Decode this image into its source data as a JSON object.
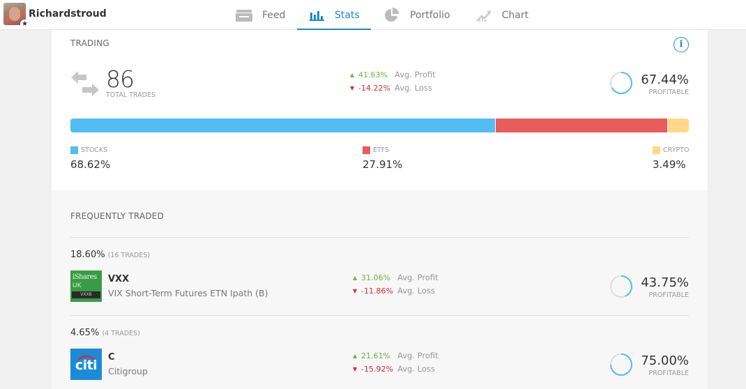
{
  "user": {
    "name": "Richardstroud",
    "badge_icon": "star-icon"
  },
  "nav": {
    "items": [
      {
        "label": "Feed",
        "icon": "feed-icon",
        "active": false
      },
      {
        "label": "Stats",
        "icon": "stats-icon",
        "active": true
      },
      {
        "label": "Portfolio",
        "icon": "portfolio-icon",
        "active": false
      },
      {
        "label": "Chart",
        "icon": "chart-icon",
        "active": false
      }
    ]
  },
  "trading": {
    "title": "TRADING",
    "info_icon": "i",
    "total_trades": "86",
    "total_trades_label": "TOTAL TRADES",
    "avg_profit": "41.63%",
    "avg_profit_label": "Avg. Profit",
    "avg_loss": "-14.22%",
    "avg_loss_label": "Avg. Loss",
    "profitable_pct": "67.44%",
    "profitable_value": 67.44,
    "profitable_label": "PROFITABLE",
    "allocation": [
      {
        "label": "STOCKS",
        "value_text": "68.62%",
        "value": 68.62,
        "color": "#52bcf3"
      },
      {
        "label": "ETFS",
        "value_text": "27.91%",
        "value": 27.91,
        "color": "#e85c5c"
      },
      {
        "label": "CRYPTO",
        "value_text": "3.49%",
        "value": 3.49,
        "color": "#ffd988"
      }
    ]
  },
  "frequently_traded": {
    "title": "FREQUENTLY TRADED",
    "items": [
      {
        "share": "18.60%",
        "trades": "(16 TRADES)",
        "ticker": "VXX",
        "name": "VIX Short-Term Futures ETN Ipath (B)",
        "logo": {
          "line1": "iShares",
          "line2": "UK",
          "line3": "VXXB",
          "bg": "#3a9b47"
        },
        "avg_profit": "31.06%",
        "avg_profit_label": "Avg. Profit",
        "avg_loss": "-11.86%",
        "avg_loss_label": "Avg. Loss",
        "profitable_pct": "43.75%",
        "profitable_value": 43.75,
        "profitable_label": "PROFITABLE"
      },
      {
        "share": "4.65%",
        "trades": "(4 TRADES)",
        "ticker": "C",
        "name": "Citigroup",
        "logo": {
          "line1": "citi",
          "bg": "#1b8bd8"
        },
        "avg_profit": "21.61%",
        "avg_profit_label": "Avg. Profit",
        "avg_loss": "-15.92%",
        "avg_loss_label": "Avg. Loss",
        "profitable_pct": "75.00%",
        "profitable_value": 75.0,
        "profitable_label": "PROFITABLE"
      }
    ]
  },
  "colors": {
    "accent": "#1a8cc8",
    "profit": "#6db33f",
    "loss": "#e0272c",
    "ring_track": "#dddddd",
    "ring_fill": "#52bcf3"
  }
}
